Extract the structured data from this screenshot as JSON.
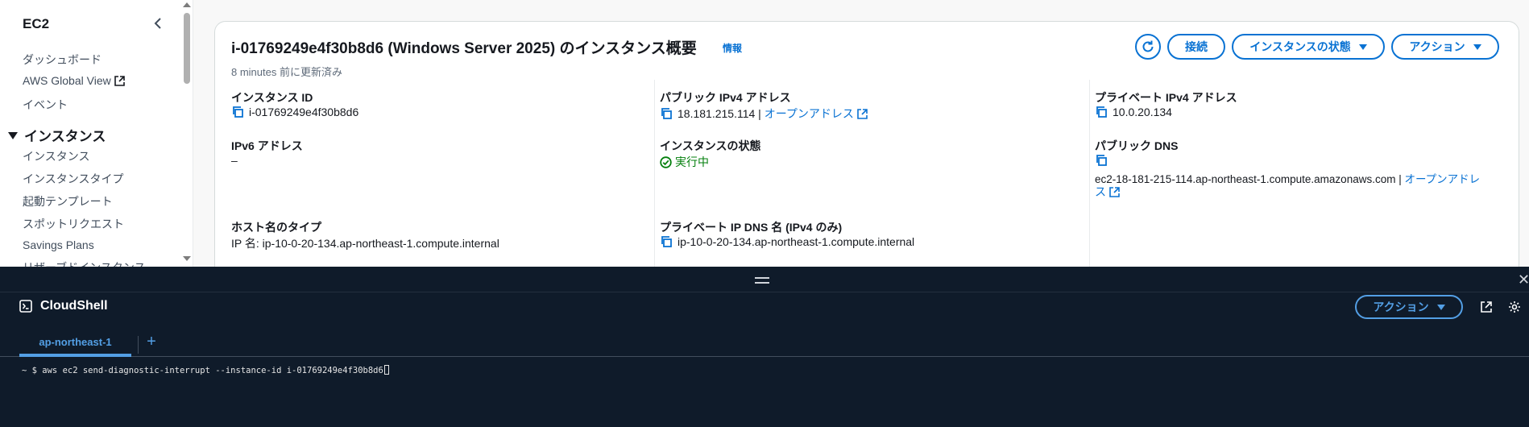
{
  "sidebar": {
    "title": "EC2",
    "items_top": [
      {
        "label": "ダッシュボード"
      },
      {
        "label": "AWS Global View"
      },
      {
        "label": "イベント"
      }
    ],
    "section": "インスタンス",
    "items_section": [
      {
        "label": "インスタンス"
      },
      {
        "label": "インスタンスタイプ"
      },
      {
        "label": "起動テンプレート"
      },
      {
        "label": "スポットリクエスト"
      },
      {
        "label": "Savings Plans"
      },
      {
        "label": "リザーブドインスタンス"
      }
    ]
  },
  "summary": {
    "title": "i-01769249e4f30b8d6 (Windows Server 2025) のインスタンス概要",
    "info_label": "情報",
    "updated": "8 minutes 前に更新済み",
    "buttons": {
      "connect": "接続",
      "instance_state": "インスタンスの状態",
      "actions": "アクション"
    },
    "fields": {
      "instance_id_label": "インスタンス ID",
      "instance_id": "i-01769249e4f30b8d6",
      "public_ipv4_label": "パブリック IPv4 アドレス",
      "public_ipv4": "18.181.215.114",
      "open_address": "オープンアドレス",
      "private_ipv4_label": "プライベート IPv4 アドレス",
      "private_ipv4": "10.0.20.134",
      "ipv6_label": "IPv6 アドレス",
      "ipv6": "–",
      "state_label": "インスタンスの状態",
      "state": "実行中",
      "public_dns_label": "パブリック DNS",
      "public_dns": "ec2-18-181-215-114.ap-northeast-1.compute.amazonaws.com",
      "public_dns_open": "オープンアドレ",
      "public_dns_open_tail": "ス",
      "hostname_type_label": "ホスト名のタイプ",
      "hostname_type": "IP 名: ip-10-0-20-134.ap-northeast-1.compute.internal",
      "private_dns_label": "プライベート IP DNS 名 (IPv4 のみ)",
      "private_dns": "ip-10-0-20-134.ap-northeast-1.compute.internal"
    }
  },
  "cloudshell": {
    "title": "CloudShell",
    "action_label": "アクション",
    "tab": "ap-northeast-1",
    "add_tab": "+",
    "close": "✕",
    "terminal_line": "~ $ aws ec2 send-diagnostic-interrupt --instance-id i-01769249e4f30b8d6"
  },
  "colors": {
    "accent": "#0972d3",
    "cloudshell_bg": "#0f1b2a",
    "cloudshell_accent": "#539fe5",
    "success": "#037f0c"
  }
}
